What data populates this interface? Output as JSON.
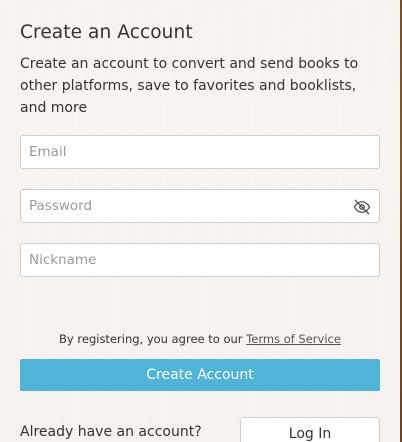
{
  "form": {
    "title": "Create an Account",
    "description": "Create an account to convert and send books to other platforms, save to favorites and booklists, and more",
    "email_placeholder": "Email",
    "password_placeholder": "Password",
    "nickname_placeholder": "Nickname",
    "password_toggle_icon": "eye-slash-icon",
    "terms_prefix": "By registering, you agree to our ",
    "terms_link": "Terms of Service",
    "create_button": "Create Account",
    "already_text": "Already have an account?",
    "login_button": "Log In"
  },
  "colors": {
    "primary": "#4fb4d8",
    "text": "#333333",
    "border": "#cfcfcf"
  }
}
